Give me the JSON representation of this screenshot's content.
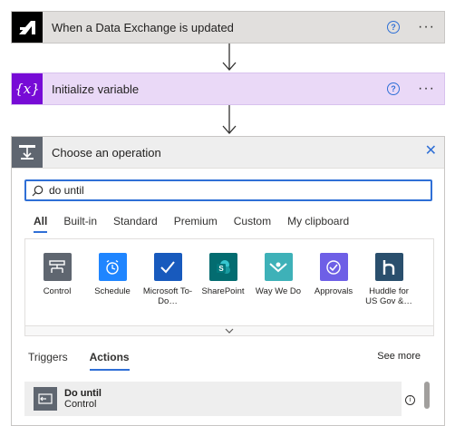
{
  "steps": [
    {
      "title": "When a Data Exchange is updated",
      "help": "?",
      "more": "···"
    },
    {
      "title": "Initialize variable",
      "help": "?",
      "more": "···",
      "icon_text": "{x}"
    }
  ],
  "panel": {
    "title": "Choose an operation",
    "search": {
      "value": "do until"
    },
    "tabs": [
      "All",
      "Built-in",
      "Standard",
      "Premium",
      "Custom",
      "My clipboard"
    ],
    "connectors": [
      {
        "label": "Control",
        "icon": "control-icon",
        "color": "#5f6670"
      },
      {
        "label": "Schedule",
        "icon": "alarm-clock-icon",
        "color": "#1f85ff"
      },
      {
        "label": "Microsoft To-\nDo…",
        "icon": "checkmark-icon",
        "color": "#185abd"
      },
      {
        "label": "SharePoint",
        "icon": "sharepoint-icon",
        "color": "#036c70"
      },
      {
        "label": "Way We Do",
        "icon": "waywedo-icon",
        "color": "#3eb1b8"
      },
      {
        "label": "Approvals",
        "icon": "approvals-icon",
        "color": "#6e5fe6"
      },
      {
        "label": "Huddle for\nUS Gov &…",
        "icon": "huddle-icon",
        "color": "#2a4f6d"
      }
    ],
    "subtabs": [
      "Triggers",
      "Actions"
    ],
    "see_more": "See more",
    "results": [
      {
        "title": "Do until",
        "subtitle": "Control",
        "icon": "do-until-icon"
      }
    ]
  },
  "colors": {
    "accent": "#2f6fd6",
    "variable": "#770bd6"
  }
}
